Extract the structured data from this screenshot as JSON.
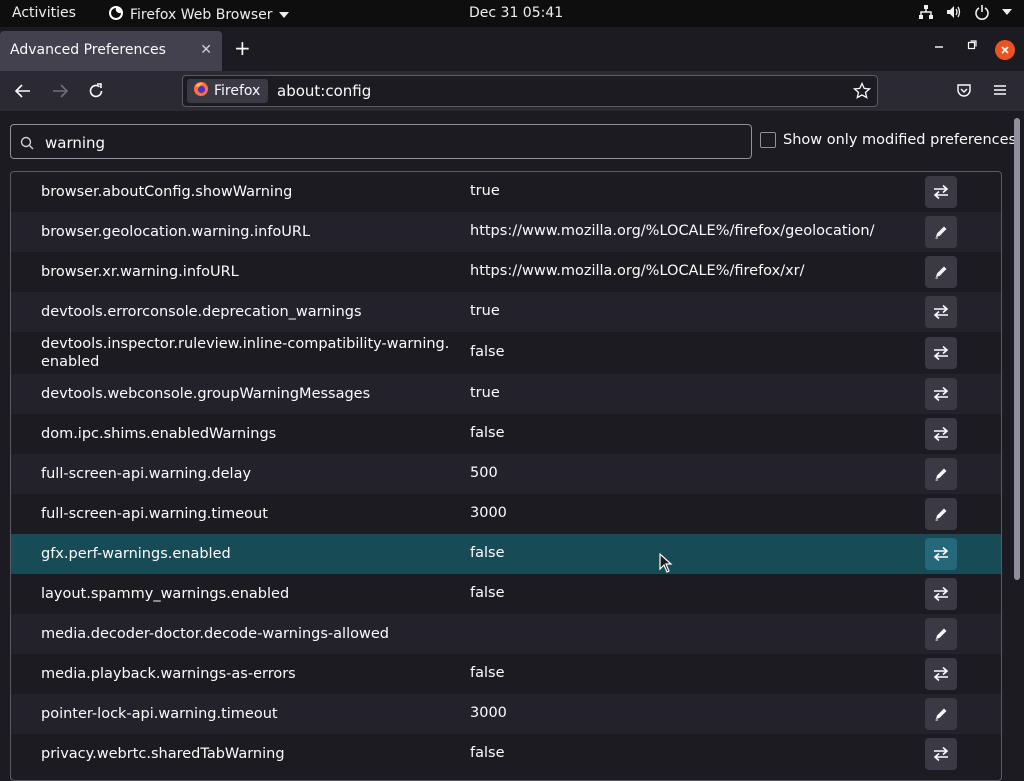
{
  "system_bar": {
    "activities": "Activities",
    "app_name": "Firefox Web Browser",
    "clock": "Dec 31  05:41"
  },
  "browser": {
    "tab_title": "Advanced Preferences",
    "identity_label": "Firefox",
    "url": "about:config"
  },
  "config": {
    "search_value": "warning",
    "modified_only_label": "Show only modified preferences",
    "modified_only_checked": false,
    "prefs": [
      {
        "name": "browser.aboutConfig.showWarning",
        "value": "true",
        "action": "toggle"
      },
      {
        "name": "browser.geolocation.warning.infoURL",
        "value": "https://www.mozilla.org/%LOCALE%/firefox/geolocation/",
        "action": "edit"
      },
      {
        "name": "browser.xr.warning.infoURL",
        "value": "https://www.mozilla.org/%LOCALE%/firefox/xr/",
        "action": "edit"
      },
      {
        "name": "devtools.errorconsole.deprecation_warnings",
        "value": "true",
        "action": "toggle"
      },
      {
        "name": "devtools.inspector.ruleview.inline-compatibility-warning.\nenabled",
        "value": "false",
        "action": "toggle"
      },
      {
        "name": "devtools.webconsole.groupWarningMessages",
        "value": "true",
        "action": "toggle"
      },
      {
        "name": "dom.ipc.shims.enabledWarnings",
        "value": "false",
        "action": "toggle"
      },
      {
        "name": "full-screen-api.warning.delay",
        "value": "500",
        "action": "edit"
      },
      {
        "name": "full-screen-api.warning.timeout",
        "value": "3000",
        "action": "edit"
      },
      {
        "name": "gfx.perf-warnings.enabled",
        "value": "false",
        "action": "toggle",
        "selected": true
      },
      {
        "name": "layout.spammy_warnings.enabled",
        "value": "false",
        "action": "toggle"
      },
      {
        "name": "media.decoder-doctor.decode-warnings-allowed",
        "value": "",
        "action": "edit"
      },
      {
        "name": "media.playback.warnings-as-errors",
        "value": "false",
        "action": "toggle"
      },
      {
        "name": "pointer-lock-api.warning.timeout",
        "value": "3000",
        "action": "edit"
      },
      {
        "name": "privacy.webrtc.sharedTabWarning",
        "value": "false",
        "action": "toggle"
      }
    ]
  },
  "icons": {
    "toggle": "toggle-arrows-icon",
    "edit": "pencil-icon"
  },
  "colors": {
    "accent_close": "#e95420",
    "selected_row": "#174c57"
  }
}
